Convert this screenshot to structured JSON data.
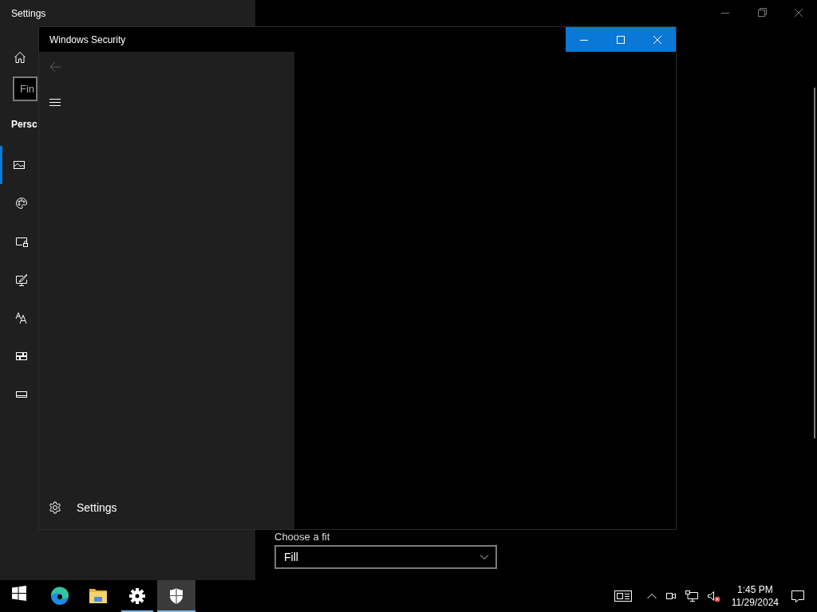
{
  "settings_window": {
    "title": "Settings",
    "search": {
      "placeholder": "Fin"
    },
    "heading": "Persc",
    "nav_items": [
      {
        "kind": "picture",
        "selected": true
      },
      {
        "kind": "palette",
        "selected": false
      },
      {
        "kind": "lockscreen",
        "selected": false
      },
      {
        "kind": "theme",
        "selected": false
      },
      {
        "kind": "fonts",
        "selected": false
      },
      {
        "kind": "start",
        "selected": false
      },
      {
        "kind": "taskbar",
        "selected": false
      }
    ],
    "fit_label": "Choose a fit",
    "fit_dropdown": {
      "value": "Fill"
    }
  },
  "security_window": {
    "title": "Windows Security",
    "back_disabled": true,
    "footer_item": "Settings"
  },
  "taskbar": {
    "apps": [
      {
        "kind": "start",
        "running": false,
        "selected": false
      },
      {
        "kind": "edge",
        "running": false,
        "selected": false
      },
      {
        "kind": "explorer",
        "running": false,
        "selected": false
      },
      {
        "kind": "settings",
        "running": true,
        "selected": false
      },
      {
        "kind": "security",
        "running": true,
        "selected": true
      }
    ],
    "tray": [
      {
        "kind": "news"
      },
      {
        "kind": "chevron"
      },
      {
        "kind": "camera"
      },
      {
        "kind": "network"
      },
      {
        "kind": "muted"
      }
    ],
    "time": "1:45 PM",
    "date": "11/29/2024"
  }
}
